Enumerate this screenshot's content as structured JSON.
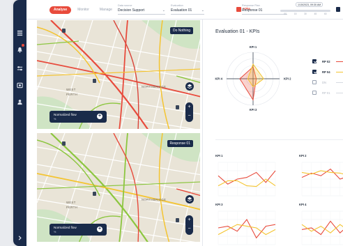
{
  "colors": {
    "accent": "#e84b3c",
    "navy": "#1a2b4a",
    "rp02": "#e84b3c",
    "rp04": "#f4c430",
    "dn": "#c5cbd5",
    "rp01": "#c5cbd5"
  },
  "sidebar": {
    "icons": [
      "grid-icon",
      "bell-icon",
      "sliders-icon",
      "camera-icon",
      "user-icon",
      "expand-chevron-icon"
    ]
  },
  "topbar": {
    "tabs": [
      {
        "label": "Analyse",
        "active": true
      },
      {
        "label": "Monitor",
        "active": false
      },
      {
        "label": "Manage",
        "active": false
      }
    ],
    "data_source": {
      "label": "Data source",
      "value": "Decision Support"
    },
    "evaluation": {
      "label": "Evaluation",
      "value": "Evaluation 01"
    },
    "kpis_label": "KPIs",
    "response_plan": {
      "label": "Response Plan",
      "value": "Response 01"
    },
    "timeline": {
      "date": "1/15/2023, 09:30 AM",
      "ticks": [
        "00",
        "15",
        "30",
        "45",
        "60"
      ]
    }
  },
  "maps": [
    {
      "scenario": "Do Nothing",
      "flow_label": "Normalized flow",
      "flow_unit": "%",
      "areas": [
        "WEST",
        "PERTH",
        "NORTHBRIDGE"
      ]
    },
    {
      "scenario": "Response 01",
      "flow_label": "Normalized flow",
      "flow_unit": "%",
      "areas": [
        "WEST",
        "PERTH",
        "NORTHBRIDGE"
      ]
    }
  ],
  "right": {
    "title": "Evaluation 01 - KPIs",
    "radar": {
      "axes": [
        "KPI 1",
        "KPI 2",
        "KPI 3",
        "KPI 4"
      ]
    },
    "legend": [
      {
        "name": "RP 02",
        "checked": true
      },
      {
        "name": "RP 04",
        "checked": true
      },
      {
        "name": "DN",
        "checked": false
      },
      {
        "name": "RP 01",
        "checked": false
      }
    ]
  },
  "chart_data": [
    {
      "type": "radar",
      "title": "",
      "categories": [
        "KPI 1",
        "KPI 2",
        "KPI 3",
        "KPI 4"
      ],
      "series": [
        {
          "name": "RP 02",
          "values": [
            0.45,
            0.12,
            0.8,
            0.5
          ]
        },
        {
          "name": "RP 04",
          "values": [
            0.55,
            0.4,
            0.3,
            0.2
          ]
        }
      ]
    },
    {
      "type": "line",
      "title": "KPI 1",
      "x": [
        1,
        2,
        3,
        4,
        5,
        6,
        7
      ],
      "series": [
        {
          "name": "RP 02",
          "values": [
            0.6,
            0.35,
            0.5,
            0.55,
            0.7,
            0.4,
            0.75
          ]
        },
        {
          "name": "RP 04",
          "values": [
            0.3,
            0.45,
            0.45,
            0.3,
            0.28,
            0.5,
            0.3
          ]
        }
      ]
    },
    {
      "type": "line",
      "title": "KPI 2",
      "x": [
        1,
        2,
        3,
        4,
        5,
        6,
        7
      ],
      "series": [
        {
          "name": "RP 02",
          "values": [
            0.55,
            0.68,
            0.6,
            0.8,
            0.5,
            0.6,
            0.4
          ]
        },
        {
          "name": "RP 04",
          "values": [
            0.7,
            0.65,
            0.75,
            0.7,
            0.68,
            0.6,
            0.55
          ]
        }
      ]
    },
    {
      "type": "line",
      "title": "KPI 3",
      "x": [
        1,
        2,
        3,
        4,
        5,
        6,
        7
      ],
      "series": [
        {
          "name": "RP 02",
          "values": [
            0.5,
            0.55,
            0.4,
            0.75,
            0.2,
            0.55,
            0.6
          ]
        },
        {
          "name": "RP 04",
          "values": [
            0.3,
            0.45,
            0.6,
            0.55,
            0.5,
            0.3,
            0.45
          ]
        }
      ]
    },
    {
      "type": "line",
      "title": "KPI 4",
      "x": [
        1,
        2,
        3,
        4,
        5,
        6,
        7
      ],
      "series": [
        {
          "name": "RP 02",
          "values": [
            0.45,
            0.5,
            0.3,
            0.7,
            0.35,
            0.6,
            0.45
          ]
        },
        {
          "name": "RP 04",
          "values": [
            0.6,
            0.4,
            0.55,
            0.35,
            0.6,
            0.4,
            0.5
          ]
        }
      ]
    }
  ]
}
